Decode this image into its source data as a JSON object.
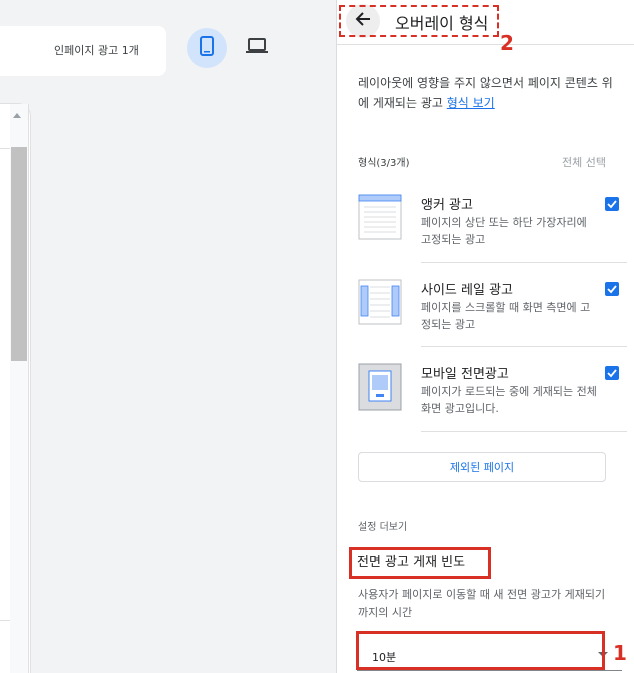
{
  "left": {
    "top_bar_text": "인페이지 광고 1개",
    "device_mobile_icon": "smartphone-icon",
    "device_desktop_icon": "laptop-icon"
  },
  "header": {
    "back_icon": "arrow-left-icon",
    "title": "오버레이 형식"
  },
  "description": {
    "text": "레이아웃에 영향을 주지 않으면서 페이지 콘텐츠 위에 게재되는 광고 ",
    "link": "형식 보기"
  },
  "formats": {
    "heading": "형식(3/3개)",
    "select_all": "전체 선택",
    "items": [
      {
        "name": "앵커 광고",
        "desc": "페이지의 상단 또는 하단 가장자리에 고정되는 광고",
        "checked": true
      },
      {
        "name": "사이드 레일 광고",
        "desc": "페이지를 스크롤할 때 화면 측면에 고정되는 광고",
        "checked": true
      },
      {
        "name": "모바일 전면광고",
        "desc": "페이지가 로드되는 중에 게재되는 전체 화면 광고입니다.",
        "checked": true
      }
    ]
  },
  "excluded_pages": "제외된 페이지",
  "settings": {
    "more_heading": "설정 더보기",
    "frequency_title": "전면 광고 게재 빈도",
    "frequency_desc": "사용자가 페이지로 이동할 때 새 전면 광고가 게재되기까지의 시간",
    "frequency_value": "10분"
  },
  "annotations": {
    "callout_1": "1",
    "callout_2": "2"
  },
  "colors": {
    "accent": "#1a73e8",
    "callout": "#d93025"
  }
}
